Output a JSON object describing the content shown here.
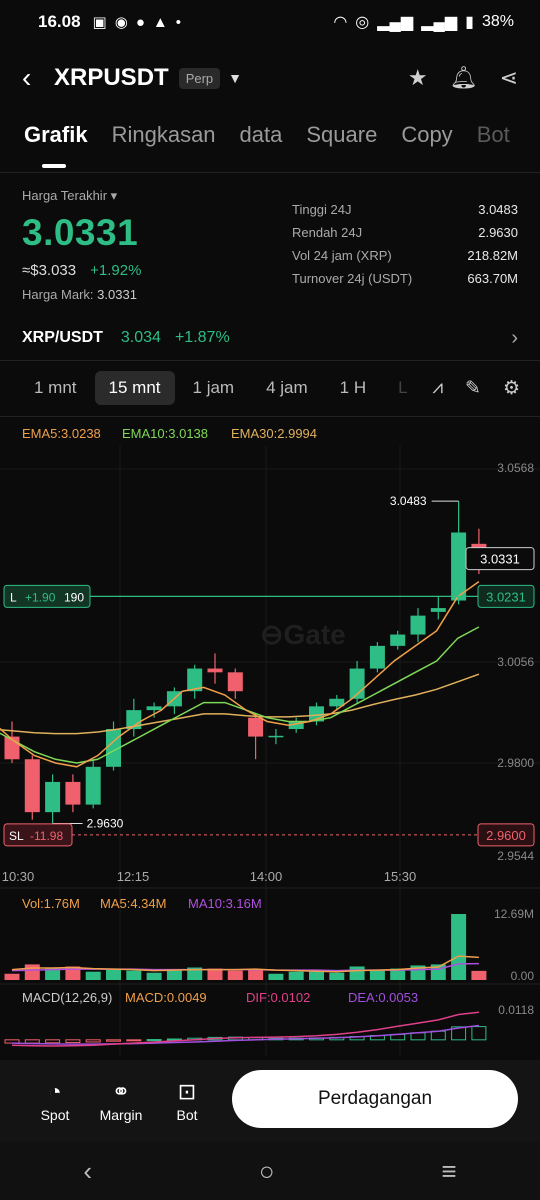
{
  "status": {
    "time": "16.08",
    "battery": "38%"
  },
  "header": {
    "symbol": "XRPUSDT",
    "badge": "Perp"
  },
  "tabs": [
    {
      "label": "Grafik"
    },
    {
      "label": "Ringkasan"
    },
    {
      "label": "data"
    },
    {
      "label": "Square"
    },
    {
      "label": "Copy"
    },
    {
      "label": "Bot"
    }
  ],
  "price": {
    "label": "Harga Terakhir ▾",
    "last": "3.0331",
    "usd": "≈$3.033",
    "change": "+1.92%",
    "mark_label": "Harga Mark:",
    "mark_value": "3.0331"
  },
  "stats": [
    {
      "k": "Tinggi 24J",
      "v": "3.0483"
    },
    {
      "k": "Rendah 24J",
      "v": "2.9630"
    },
    {
      "k": "Vol 24 jam (XRP)",
      "v": "218.82M"
    },
    {
      "k": "Turnover 24j (USDT)",
      "v": "663.70M"
    }
  ],
  "pair": {
    "name": "XRP/USDT",
    "price": "3.034",
    "change": "+1.87%"
  },
  "intervals": [
    {
      "label": "1 mnt"
    },
    {
      "label": "15 mnt"
    },
    {
      "label": "1 jam"
    },
    {
      "label": "4 jam"
    },
    {
      "label": "1 H"
    },
    {
      "label": "L"
    }
  ],
  "indicators": {
    "ema5": "EMA5:3.0238",
    "ema10": "EMA10:3.0138",
    "ema30": "EMA30:2.9994",
    "vol": "Vol:1.76M",
    "ma5": "MA5:4.34M",
    "ma10": "MA10:3.16M",
    "macd_title": "MACD(12,26,9)",
    "macd": "MACD:0.0049",
    "dif": "DIF:0.0102",
    "dea": "DEA:0.0053"
  },
  "colors": {
    "up": "#2ebd85",
    "down": "#f0616d",
    "ema5": "#f0a04b",
    "ema10": "#7ed957",
    "ema30": "#e0b15c",
    "ma10": "#b150e0",
    "dif": "#e0408a",
    "dea": "#a050e0"
  },
  "chart_data": {
    "type": "candlestick",
    "ylim": [
      2.9544,
      3.0568
    ],
    "y_ticks": [
      "3.0568",
      "3.0056",
      "2.9800",
      "2.9544"
    ],
    "x_ticks": [
      "10:30",
      "12:15",
      "14:00",
      "15:30"
    ],
    "high_label": "3.0483",
    "low_label": "2.9630",
    "current_label": "3.0331",
    "position_line": {
      "label": "L",
      "pnl": "+1.90",
      "qty": "190",
      "price": "3.0231",
      "value": 3.0231
    },
    "stop_loss": {
      "label": "SL",
      "pnl": "-11.98",
      "price": "2.9600",
      "value": 2.96
    },
    "candles": [
      {
        "o": 2.986,
        "h": 2.99,
        "l": 2.979,
        "c": 2.98
      },
      {
        "o": 2.98,
        "h": 2.981,
        "l": 2.964,
        "c": 2.966
      },
      {
        "o": 2.966,
        "h": 2.976,
        "l": 2.963,
        "c": 2.974
      },
      {
        "o": 2.974,
        "h": 2.976,
        "l": 2.966,
        "c": 2.968
      },
      {
        "o": 2.968,
        "h": 2.98,
        "l": 2.967,
        "c": 2.978
      },
      {
        "o": 2.978,
        "h": 2.99,
        "l": 2.977,
        "c": 2.988
      },
      {
        "o": 2.988,
        "h": 2.996,
        "l": 2.986,
        "c": 2.993
      },
      {
        "o": 2.993,
        "h": 2.995,
        "l": 2.991,
        "c": 2.994
      },
      {
        "o": 2.994,
        "h": 2.999,
        "l": 2.992,
        "c": 2.998
      },
      {
        "o": 2.998,
        "h": 3.005,
        "l": 2.996,
        "c": 3.004
      },
      {
        "o": 3.004,
        "h": 3.008,
        "l": 3.0,
        "c": 3.003
      },
      {
        "o": 3.003,
        "h": 3.004,
        "l": 2.996,
        "c": 2.998
      },
      {
        "o": 2.991,
        "h": 2.992,
        "l": 2.98,
        "c": 2.986
      },
      {
        "o": 2.986,
        "h": 2.988,
        "l": 2.984,
        "c": 2.9862
      },
      {
        "o": 2.988,
        "h": 2.991,
        "l": 2.987,
        "c": 2.99
      },
      {
        "o": 2.99,
        "h": 2.995,
        "l": 2.989,
        "c": 2.994
      },
      {
        "o": 2.994,
        "h": 2.997,
        "l": 2.993,
        "c": 2.996
      },
      {
        "o": 2.996,
        "h": 3.006,
        "l": 2.995,
        "c": 3.004
      },
      {
        "o": 3.004,
        "h": 3.011,
        "l": 3.003,
        "c": 3.01
      },
      {
        "o": 3.01,
        "h": 3.014,
        "l": 3.009,
        "c": 3.013
      },
      {
        "o": 3.013,
        "h": 3.02,
        "l": 3.011,
        "c": 3.018
      },
      {
        "o": 3.019,
        "h": 3.023,
        "l": 3.017,
        "c": 3.02
      },
      {
        "o": 3.022,
        "h": 3.0483,
        "l": 3.021,
        "c": 3.04
      },
      {
        "o": 3.037,
        "h": 3.041,
        "l": 3.029,
        "c": 3.0331
      }
    ],
    "ema5": [
      2.99,
      2.985,
      2.981,
      2.979,
      2.978,
      2.981,
      2.986,
      2.99,
      2.993,
      2.998,
      2.999,
      2.997,
      2.993,
      2.99,
      2.989,
      2.99,
      2.992,
      2.996,
      3.001,
      3.006,
      3.01,
      3.014,
      3.023,
      3.027
    ],
    "ema10": [
      2.988,
      2.985,
      2.982,
      2.98,
      2.979,
      2.98,
      2.983,
      2.986,
      2.989,
      2.992,
      2.995,
      2.995,
      2.993,
      2.991,
      2.99,
      2.99,
      2.991,
      2.994,
      2.997,
      3.0,
      3.003,
      3.006,
      3.012,
      3.015
    ],
    "ema30": [
      2.988,
      2.9875,
      2.987,
      2.9868,
      2.9868,
      2.9872,
      2.988,
      2.989,
      2.99,
      2.991,
      2.992,
      2.992,
      2.9915,
      2.9912,
      2.9912,
      2.9915,
      2.992,
      2.993,
      2.9945,
      2.9958,
      2.997,
      2.9985,
      3.0005,
      3.0025
    ],
    "volume": {
      "ylim": [
        0,
        12.69
      ],
      "y_ticks": [
        "12.69M",
        "0.00"
      ],
      "bars": [
        1.2,
        3.0,
        2.2,
        2.6,
        1.6,
        2.0,
        1.8,
        1.4,
        1.8,
        2.4,
        2.2,
        1.8,
        2.0,
        1.2,
        1.6,
        1.6,
        1.4,
        2.6,
        2.0,
        2.2,
        2.8,
        3.0,
        12.69,
        1.76
      ],
      "ma5": [
        2.0,
        2.3,
        2.3,
        2.4,
        2.2,
        2.1,
        2.0,
        1.8,
        1.9,
        2.0,
        2.0,
        2.0,
        2.1,
        1.9,
        1.8,
        1.7,
        1.6,
        1.8,
        1.9,
        2.0,
        2.3,
        2.5,
        4.6,
        4.34
      ],
      "ma10": [
        1.8,
        1.9,
        2.0,
        2.1,
        2.1,
        2.1,
        2.1,
        2.0,
        2.0,
        2.0,
        2.0,
        2.0,
        2.0,
        1.9,
        1.9,
        1.9,
        1.8,
        1.9,
        1.9,
        1.9,
        2.0,
        2.1,
        3.1,
        3.16
      ]
    },
    "macd": {
      "ylim": [
        -0.006,
        0.0118
      ],
      "y_ticks": [
        "0.0118"
      ],
      "hist": [
        -0.0012,
        -0.0012,
        -0.0011,
        -0.001,
        -0.0008,
        -0.0005,
        -0.0002,
        0.0001,
        0.0003,
        0.0006,
        0.0009,
        0.001,
        0.0008,
        0.0006,
        0.0006,
        0.0007,
        0.0009,
        0.0012,
        0.0016,
        0.002,
        0.0026,
        0.0032,
        0.0048,
        0.0049
      ],
      "dif": [
        -0.002,
        -0.0022,
        -0.0023,
        -0.0022,
        -0.002,
        -0.0016,
        -0.0012,
        -0.0008,
        -0.0004,
        0.0,
        0.0005,
        0.0008,
        0.0009,
        0.001,
        0.0012,
        0.0015,
        0.002,
        0.0028,
        0.0038,
        0.005,
        0.0062,
        0.0074,
        0.0094,
        0.0102
      ],
      "dea": [
        -0.0012,
        -0.0014,
        -0.0015,
        -0.0016,
        -0.0016,
        -0.0015,
        -0.0014,
        -0.0012,
        -0.001,
        -0.0008,
        -0.0005,
        -0.0002,
        0.0,
        0.0002,
        0.0004,
        0.0006,
        0.0008,
        0.0011,
        0.0015,
        0.002,
        0.0026,
        0.0032,
        0.0044,
        0.0053
      ]
    }
  },
  "bottom_nav": [
    {
      "label": "Spot"
    },
    {
      "label": "Margin"
    },
    {
      "label": "Bot"
    }
  ],
  "trade_button": "Perdagangan"
}
